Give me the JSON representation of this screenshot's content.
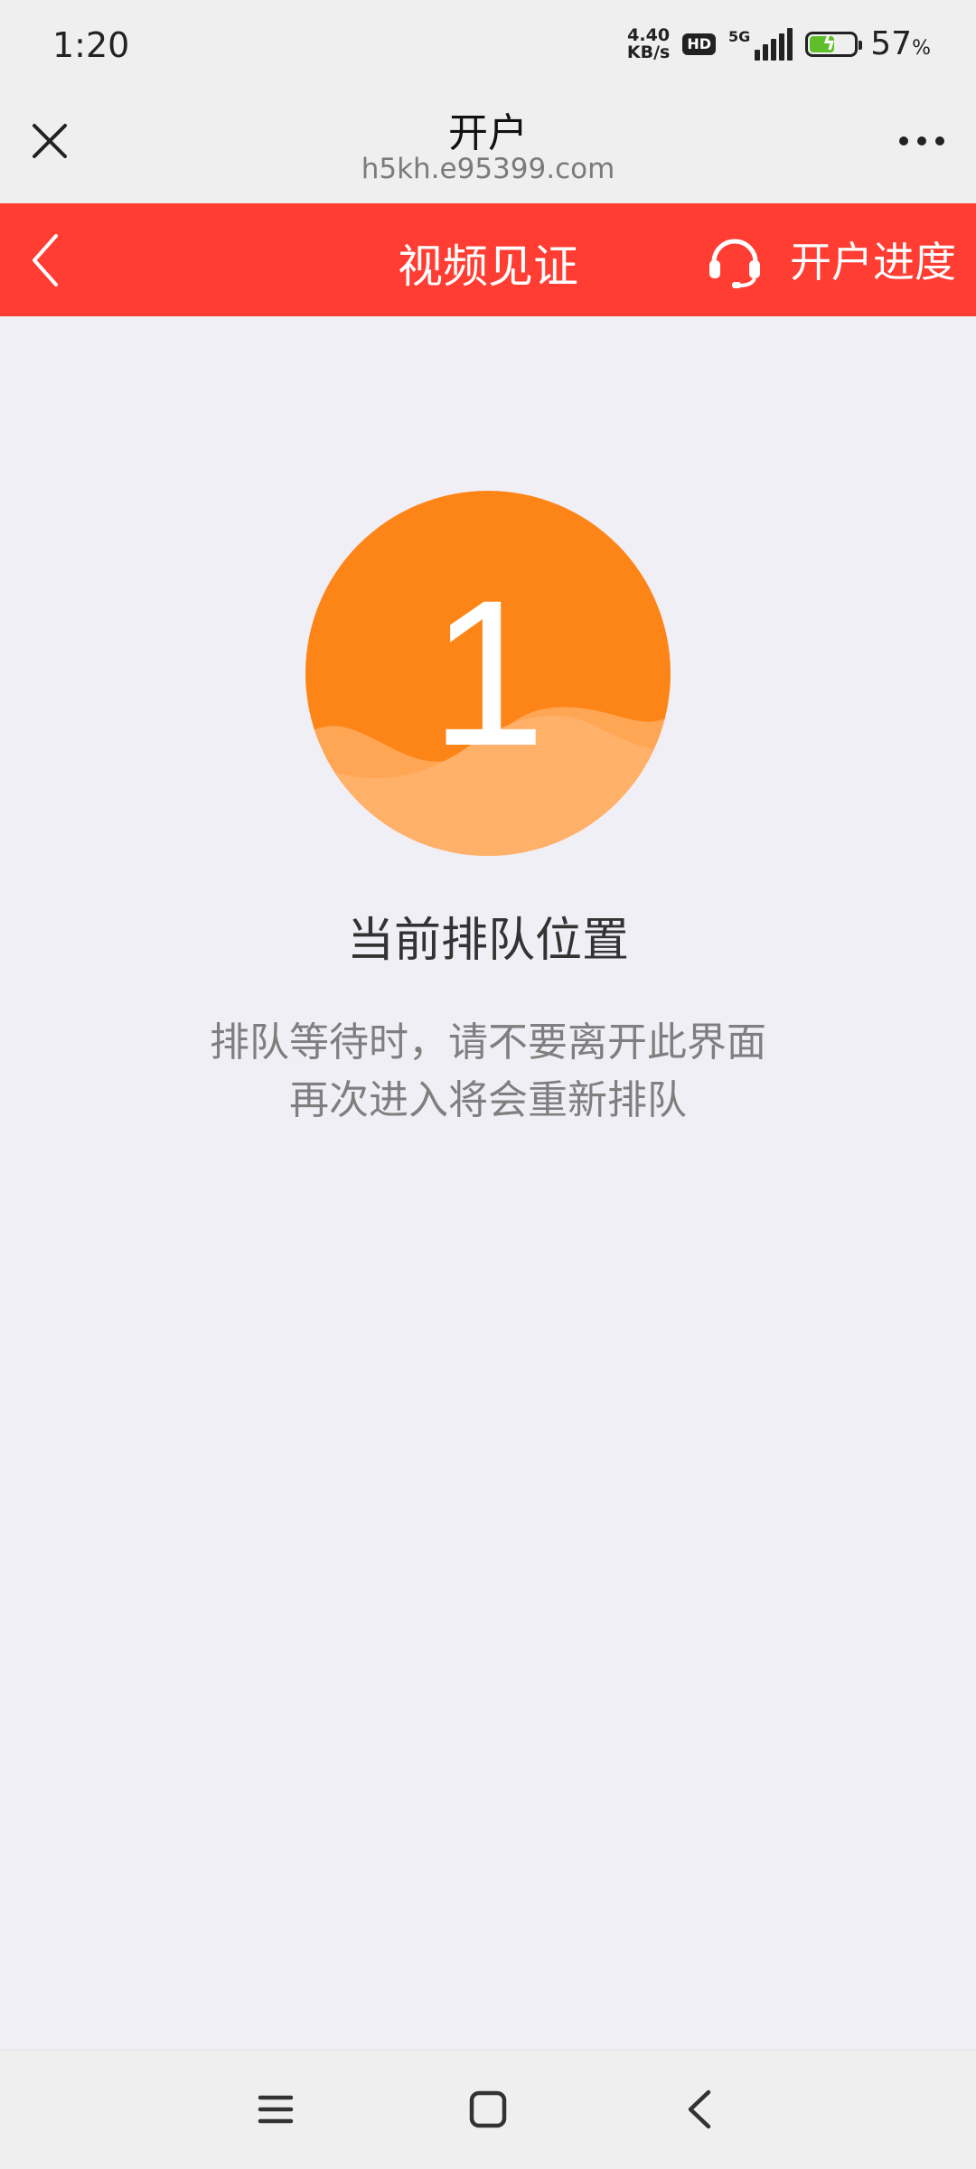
{
  "status_bar": {
    "time": "1:20",
    "net_speed_value": "4.40",
    "net_speed_unit": "KB/s",
    "hd_label": "HD",
    "network_label": "5G",
    "battery_percent": "57",
    "battery_unit": "%",
    "battery_level": 0.57
  },
  "browser_bar": {
    "title": "开户",
    "url": "h5kh.e95399.com",
    "close_icon": "close-icon",
    "more_icon": "more-horizontal-icon"
  },
  "header": {
    "title": "视频见证",
    "progress_label": "开户进度",
    "back_icon": "chevron-left-icon",
    "support_icon": "headset-icon",
    "color": "#ff3d33"
  },
  "queue": {
    "position": "1",
    "label": "当前排队位置",
    "notice_line1": "排队等待时，请不要离开此界面",
    "notice_line2": "再次进入将会重新排队",
    "circle_color": "#fd8518",
    "wave_color": "#ffb169"
  },
  "nav_bar": {
    "menu_icon": "menu-icon",
    "home_icon": "home-square-icon",
    "back_icon": "back-chevron-icon"
  }
}
